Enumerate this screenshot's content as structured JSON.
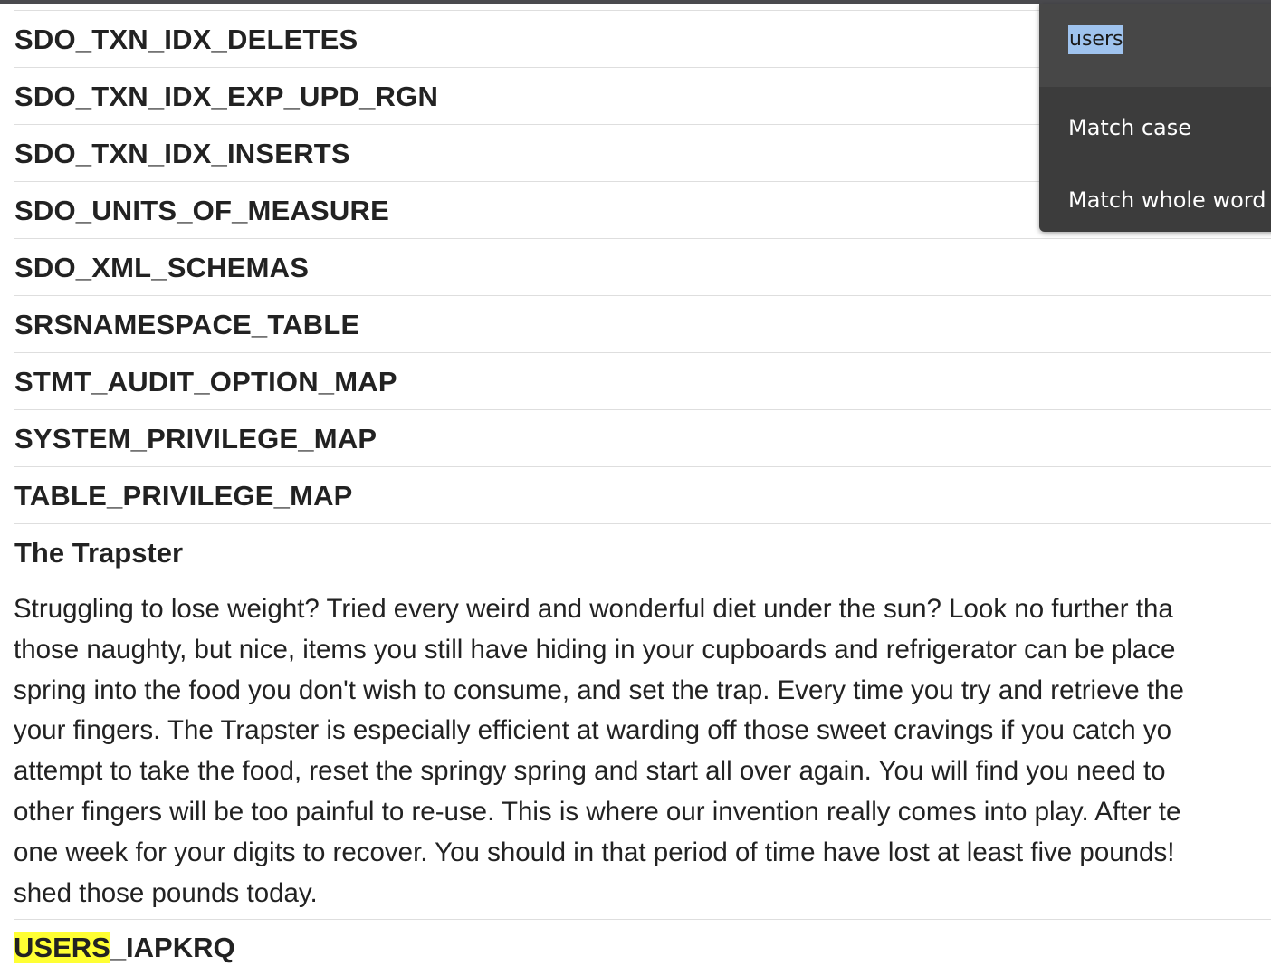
{
  "tables": [
    "SDO_TXN_IDX_DELETES",
    "SDO_TXN_IDX_EXP_UPD_RGN",
    "SDO_TXN_IDX_INSERTS",
    "SDO_UNITS_OF_MEASURE",
    "SDO_XML_SCHEMAS",
    "SRSNAMESPACE_TABLE",
    "STMT_AUDIT_OPTION_MAP",
    "SYSTEM_PRIVILEGE_MAP",
    "TABLE_PRIVILEGE_MAP"
  ],
  "article": {
    "title": "The Trapster",
    "lines": [
      "Struggling to lose weight? Tried every weird and wonderful diet under the sun? Look no further tha",
      "those naughty, but nice, items you still have hiding in your cupboards and refrigerator can be place",
      "spring into the food you don't wish to consume, and set the trap. Every time you try and retrieve the",
      "your fingers. The Trapster is especially efficient at warding off those sweet cravings if you catch yo",
      "attempt to take the food, reset the springy spring and start all over again. You will find you need to",
      "other fingers will be too painful to re-use. This is where our invention really comes into play. After te",
      "one week for your digits to recover. You should in that period of time have lost at least five pounds!",
      "shed those pounds today."
    ]
  },
  "result": {
    "highlight": "USERS",
    "rest": "_IAPKRQ"
  },
  "find": {
    "query": "users",
    "match_case_label": "Match case",
    "match_whole_word_label": "Match whole word",
    "highlight_color": "#ffff33",
    "selection_color": "#9fc3ee",
    "panel_color": "#3c3c3c"
  }
}
